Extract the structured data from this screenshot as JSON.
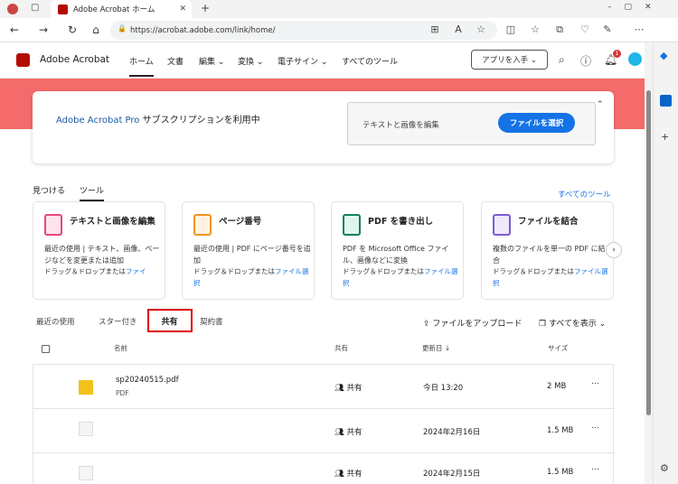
{
  "browser": {
    "tab_title": "Adobe Acrobat ホーム",
    "url": "https://acrobat.adobe.com/link/home/"
  },
  "app": {
    "brand": "Adobe Acrobat",
    "nav": [
      "ホーム",
      "文書",
      "編集 ⌄",
      "変換 ⌄",
      "電子サイン ⌄",
      "すべてのツール"
    ],
    "get_app": "アプリを入手 ⌄",
    "notification_count": "1"
  },
  "banner": {
    "product": "Adobe Acrobat Pro",
    "subtitle_rest": " サブスクリプションを利用中",
    "drop_text": "テキストと画像を編集",
    "select_file": "ファイルを選択"
  },
  "tools_section": {
    "tabs": [
      "見つける",
      "ツール"
    ],
    "all_tools": "すべてのツール",
    "cards": [
      {
        "title": "テキストと画像を編集",
        "line1": "最近の使用 | テキスト、画像、ページなどを変更または追加",
        "drag": "ドラッグ＆ドロップまたは",
        "link": "ファイ"
      },
      {
        "title": "ページ番号",
        "line1": "最近の使用 | PDF にページ番号を追加",
        "drag": "ドラッグ＆ドロップまたは",
        "link": "ファイル選択"
      },
      {
        "title": "PDF を書き出し",
        "line1": "PDF を Microsoft Office ファイル、画像などに変換",
        "drag": "ドラッグ＆ドロップまたは",
        "link": "ファイル選択"
      },
      {
        "title": "ファイルを結合",
        "line1": "複数のファイルを単一の PDF に結合",
        "drag": "ドラッグ＆ドロップまたは",
        "link": "ファイル選択"
      }
    ]
  },
  "files": {
    "tabs": [
      "最近の使用",
      "スター付き",
      "共有",
      "契約書"
    ],
    "upload": "ファイルをアップロード",
    "show_all": "すべてを表示",
    "headers": {
      "name": "名前",
      "shared": "共有",
      "updated": "更新日 ↓",
      "size": "サイズ"
    },
    "rows": [
      {
        "name": "sp20240515.pdf",
        "type": "PDF",
        "shared": "共有",
        "updated": "今日 13:20",
        "size": "2 MB"
      },
      {
        "name": "",
        "type": "",
        "shared": "共有",
        "updated": "2024年2月16日",
        "size": "1.5 MB"
      },
      {
        "name": "",
        "type": "",
        "shared": "共有",
        "updated": "2024年2月15日",
        "size": "1.5 MB"
      }
    ]
  },
  "colors": {
    "accent": "#1473e6",
    "banner": "#f56b6b",
    "highlight": "#e00000"
  }
}
